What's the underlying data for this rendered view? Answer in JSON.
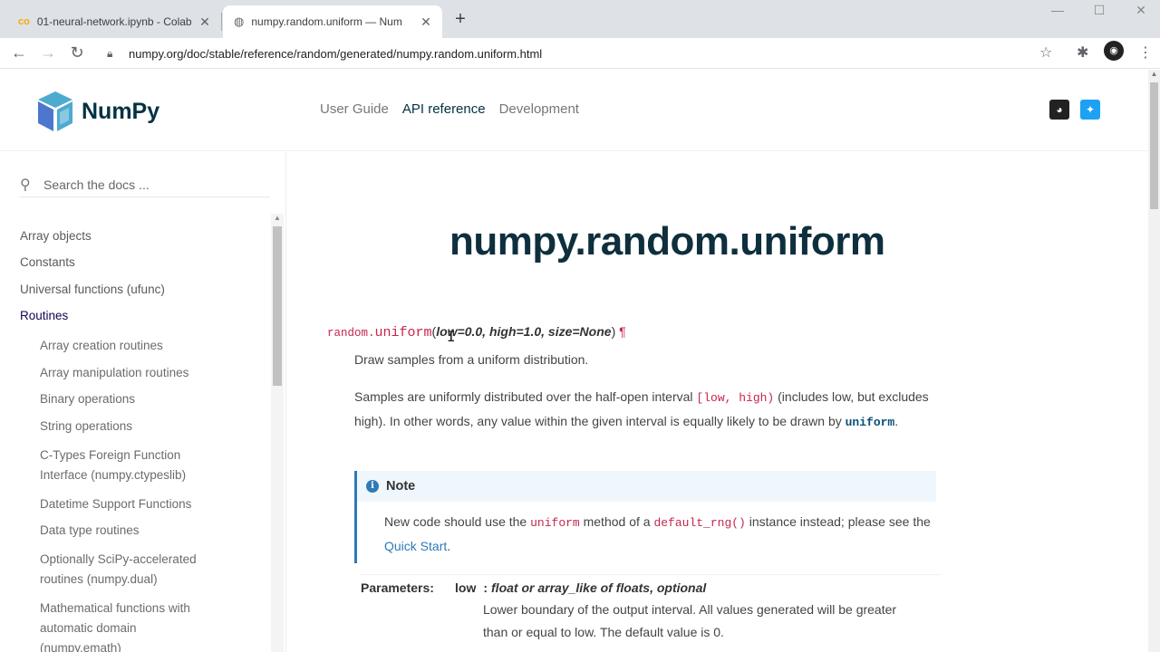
{
  "browser": {
    "tabs": [
      {
        "title": "01-neural-network.ipynb - Colab",
        "icon": "colab-icon"
      },
      {
        "title": "numpy.random.uniform — Num",
        "icon": "globe-icon"
      }
    ],
    "new_tab": "+",
    "address": "numpy.org/doc/stable/reference/random/generated/numpy.random.uniform.html"
  },
  "header": {
    "logo_text": "NumPy",
    "nav": [
      "User Guide",
      "API reference",
      "Development"
    ],
    "active_nav": "API reference"
  },
  "sidebar": {
    "search_placeholder": "Search the docs ...",
    "items": [
      {
        "label": "Array objects",
        "level": 0
      },
      {
        "label": "Constants",
        "level": 0
      },
      {
        "label": "Universal functions (ufunc)",
        "level": 0
      },
      {
        "label": "Routines",
        "level": 0,
        "active": true
      },
      {
        "label": "Array creation routines",
        "level": 1
      },
      {
        "label": "Array manipulation routines",
        "level": 1
      },
      {
        "label": "Binary operations",
        "level": 1
      },
      {
        "label": "String operations",
        "level": 1
      },
      {
        "label": "C-Types Foreign Function Interface (numpy.ctypeslib)",
        "level": 1
      },
      {
        "label": "Datetime Support Functions",
        "level": 1
      },
      {
        "label": "Data type routines",
        "level": 1
      },
      {
        "label": "Optionally SciPy-accelerated routines (numpy.dual)",
        "level": 1
      },
      {
        "label": "Mathematical functions with automatic domain (numpy.emath)",
        "level": 1
      }
    ]
  },
  "main": {
    "title": "numpy.random.uniform",
    "signature": {
      "prefix": "random.",
      "name": "uniform",
      "open": "(",
      "params": "low=0.0, high=1.0, size=None",
      "close": ")",
      "pilcrow": "¶"
    },
    "summary": "Draw samples from a uniform distribution.",
    "para1_a": "Samples are uniformly distributed over the half-open interval ",
    "para1_code": "[low, high)",
    "para1_b": " (includes low, but excludes high). In other words, any value within the given interval is equally likely to be drawn by ",
    "para1_code2": "uniform",
    "para1_c": ".",
    "note": {
      "title": "Note",
      "text_a": "New code should use the ",
      "code1": "uniform",
      "text_b": " method of a ",
      "code2": "default_rng()",
      "text_c": " instance instead; please see the ",
      "link": "Quick Start",
      "text_d": "."
    },
    "parameters": {
      "label": "Parameters:",
      "name": "low",
      "sep": ":",
      "type": "float or array_like of floats, optional",
      "desc": "Lower boundary of the output interval. All values generated will be greater than or equal to low. The default value is 0."
    }
  }
}
